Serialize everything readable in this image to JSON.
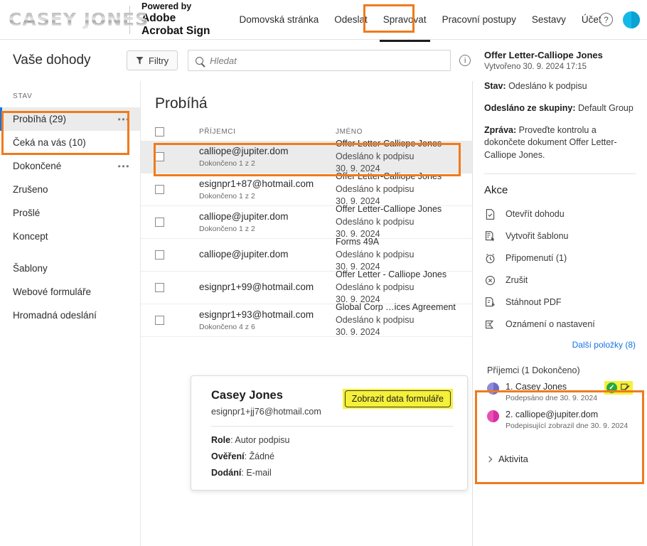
{
  "topbar": {
    "logo_text": "CASEY JONES",
    "powered_by": "Powered by",
    "brand_line1": "Adobe",
    "brand_line2": "Acrobat Sign",
    "nav": [
      {
        "label": "Domovská stránka",
        "active": false
      },
      {
        "label": "Odeslat",
        "active": false
      },
      {
        "label": "Spravovat",
        "active": true
      },
      {
        "label": "Pracovní postupy",
        "active": false
      },
      {
        "label": "Sestavy",
        "active": false
      },
      {
        "label": "Účet",
        "active": false
      }
    ],
    "help_icon": "question-mark-circle-icon",
    "avatar_icon": "user-avatar-icon"
  },
  "toolbar": {
    "page_title": "Vaše dohody",
    "filters_label": "Filtry",
    "search_placeholder": "Hledat",
    "search_value": "",
    "info_icon": "info-circle-icon"
  },
  "sidebar": {
    "section_label": "STAV",
    "items": [
      {
        "label": "Probíhá (29)",
        "selected": true,
        "has_menu": true
      },
      {
        "label": "Čeká na vás (10)",
        "selected": false,
        "has_menu": false
      },
      {
        "label": "Dokončené",
        "selected": false,
        "has_menu": true
      },
      {
        "label": "Zrušeno",
        "selected": false,
        "has_menu": false
      },
      {
        "label": "Prošlé",
        "selected": false,
        "has_menu": false
      },
      {
        "label": "Koncept",
        "selected": false,
        "has_menu": false
      }
    ],
    "items2": [
      {
        "label": "Šablony"
      },
      {
        "label": "Webové formuláře"
      },
      {
        "label": "Hromadná odeslání"
      }
    ]
  },
  "list": {
    "heading": "Probíhá",
    "col_recipients": "PŘÍJEMCI",
    "col_name": "JMÉNO",
    "rows": [
      {
        "email": "calliope@jupiter.dom",
        "sub": "Dokončeno 1 z 2",
        "name": "Offer Letter-Calliope Jones",
        "status": "Odesláno k podpisu",
        "date": "30. 9. 2024",
        "selected": true
      },
      {
        "email": "esignpr1+87@hotmail.com",
        "sub": "Dokončeno 1 z 2",
        "name": "Offer Letter-Calliope Jones",
        "status": "Odesláno k podpisu",
        "date": "30. 9. 2024",
        "selected": false
      },
      {
        "email": "calliope@jupiter.dom",
        "sub": "Dokončeno 1 z 2",
        "name": "Offer Letter-Calliope Jones",
        "status": "Odesláno k podpisu",
        "date": "30. 9. 2024",
        "selected": false
      },
      {
        "email": "calliope@jupiter.dom",
        "sub": "",
        "name": "Forms 49A",
        "status": "Odesláno k podpisu",
        "date": "30. 9. 2024",
        "selected": false
      },
      {
        "email": "esignpr1+99@hotmail.com",
        "sub": "",
        "name": "Offer Letter - Calliope Jones",
        "status": "Odesláno k podpisu",
        "date": "30. 9. 2024",
        "selected": false
      },
      {
        "email": "esignpr1+93@hotmail.com",
        "sub": "Dokončeno 4 z 6",
        "name": "Global Corp …ices Agreement",
        "status": "Odesláno k podpisu",
        "date": "30. 9. 2024",
        "selected": false
      }
    ]
  },
  "card": {
    "name": "Casey Jones",
    "email": "esignpr1+jj76@hotmail.com",
    "form_data_button": "Zobrazit data formuláře",
    "role_label": "Role",
    "role_value": "Autor podpisu",
    "verify_label": "Ověření",
    "verify_value": "Žádné",
    "delivery_label": "Dodání",
    "delivery_value": "E-mail"
  },
  "detail": {
    "title": "Offer Letter-Calliope Jones",
    "created": "Vytvořeno 30. 9. 2024 17:15",
    "status_label": "Stav:",
    "status_value": "Odesláno k podpisu",
    "group_label": "Odesláno ze skupiny:",
    "group_value": "Default Group",
    "message_label": "Zpráva:",
    "message_value": "Proveďte kontrolu a dokončete dokument Offer Letter-Calliope Jones.",
    "actions_heading": "Akce",
    "actions": [
      {
        "label": "Otevřít dohodu",
        "icon": "document-check-icon"
      },
      {
        "label": "Vytvořit šablonu",
        "icon": "document-cursor-icon"
      },
      {
        "label": "Připomenutí (1)",
        "icon": "alarm-clock-icon"
      },
      {
        "label": "Zrušit",
        "icon": "cancel-circle-icon"
      },
      {
        "label": "Stáhnout PDF",
        "icon": "download-pdf-icon"
      },
      {
        "label": "Oznámení o nastavení",
        "icon": "notification-flag-icon"
      }
    ],
    "more_items": "Další položky (8)",
    "recipients_heading": "Příjemci (1 Dokončeno)",
    "recipients": [
      {
        "order": "1.",
        "name": "Casey Jones",
        "sub": "Podepsáno dne 30. 9. 2024",
        "avatar": "purple",
        "badges": true
      },
      {
        "order": "2.",
        "name": "calliope@jupiter.dom",
        "sub": "Podepisující zobrazil dne 30. 9. 2024",
        "avatar": "magenta",
        "badges": false
      }
    ],
    "activity_label": "Aktivita"
  },
  "colors": {
    "highlight_orange": "#f07a1c",
    "highlight_yellow": "#f5f03a",
    "accent_blue": "#1473e6",
    "success_green": "#26a93f"
  }
}
